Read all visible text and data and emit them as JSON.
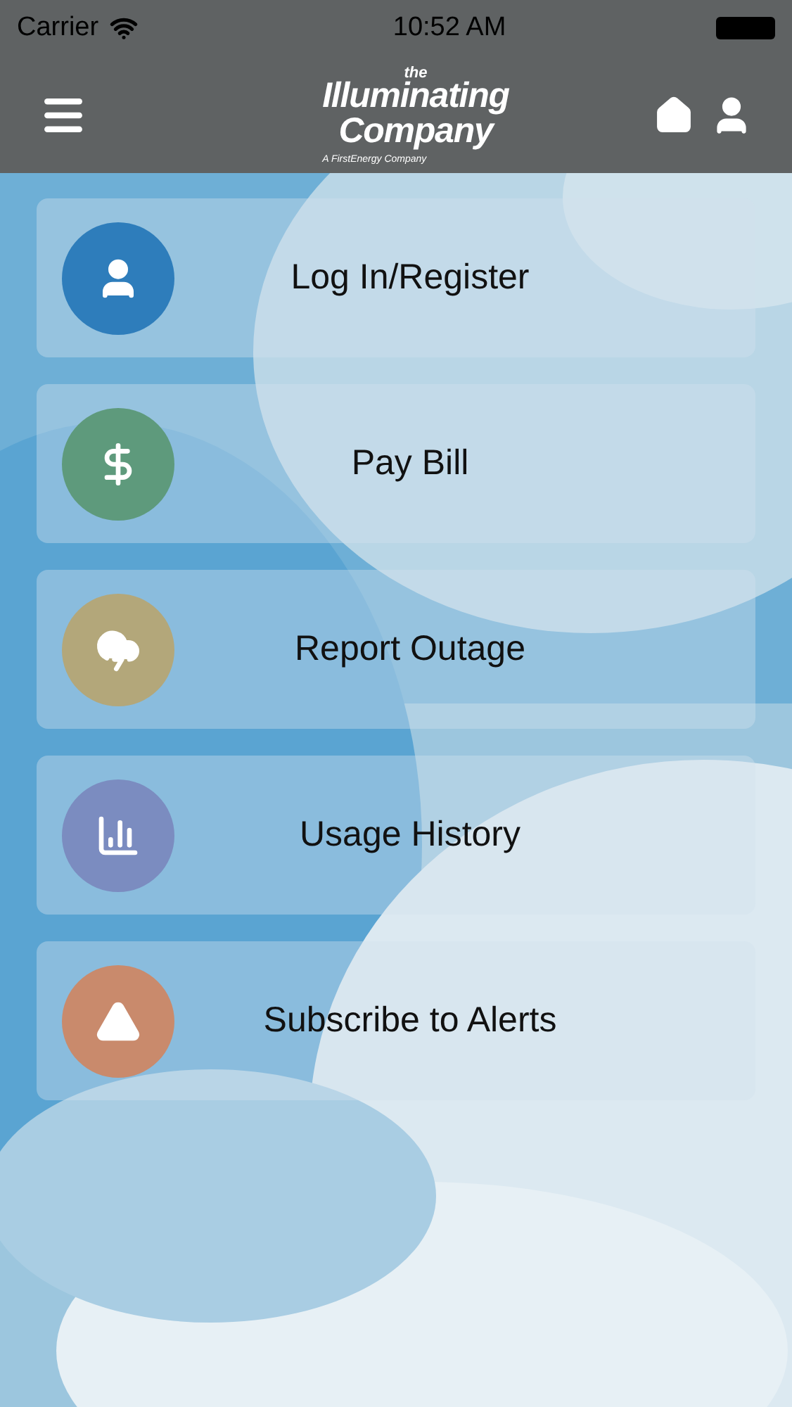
{
  "status_bar": {
    "carrier": "Carrier",
    "time": "10:52 AM"
  },
  "header": {
    "logo": {
      "top": "the",
      "name": "Illuminating",
      "name2": "Company",
      "tagline": "A FirstEnergy Company"
    }
  },
  "menu": [
    {
      "label": "Log In/Register",
      "kind": "user",
      "color": "#2e7dbb"
    },
    {
      "label": "Pay Bill",
      "kind": "dollar",
      "color": "#5e9a7c"
    },
    {
      "label": "Report Outage",
      "kind": "storm",
      "color": "#b3a77a"
    },
    {
      "label": "Usage History",
      "kind": "chart",
      "color": "#7b8cc0"
    },
    {
      "label": "Subscribe to Alerts",
      "kind": "alert",
      "color": "#c98a6c"
    }
  ]
}
